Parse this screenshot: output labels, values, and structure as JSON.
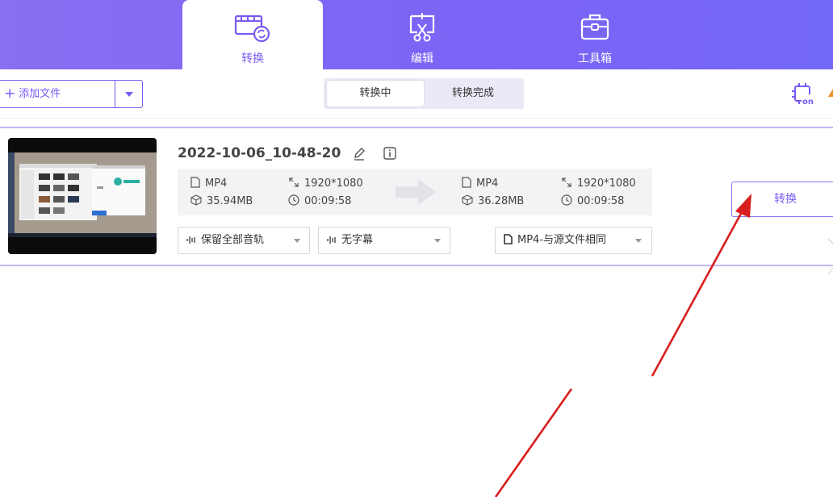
{
  "header": {
    "tabs": [
      {
        "label": "转换",
        "icon": "video-convert-icon",
        "active": true
      },
      {
        "label": "编辑",
        "icon": "scissors-edit-icon",
        "active": false
      },
      {
        "label": "工具箱",
        "icon": "toolbox-icon",
        "active": false
      }
    ]
  },
  "toolbar": {
    "add_file_label": "添加文件",
    "segments": [
      {
        "label": "转换中",
        "active": true
      },
      {
        "label": "转换完成",
        "active": false
      }
    ],
    "gpu_icon": "gpu-acceleration-on-icon"
  },
  "file": {
    "name": "2022-10-06_10-48-20",
    "source": {
      "format": "MP4",
      "resolution": "1920*1080",
      "size": "35.94MB",
      "duration": "00:09:58"
    },
    "target": {
      "format": "MP4",
      "resolution": "1920*1080",
      "size": "36.28MB",
      "duration": "00:09:58"
    },
    "audio_track": "保留全部音轨",
    "subtitle": "无字幕",
    "output_format": "MP4-与源文件相同",
    "convert_label": "转换"
  },
  "colors": {
    "brand": "#7a5af5",
    "header_gradient_start": "#8b6ff2",
    "header_gradient_end": "#7468f8",
    "annotation_arrow": "#d81e1e"
  }
}
